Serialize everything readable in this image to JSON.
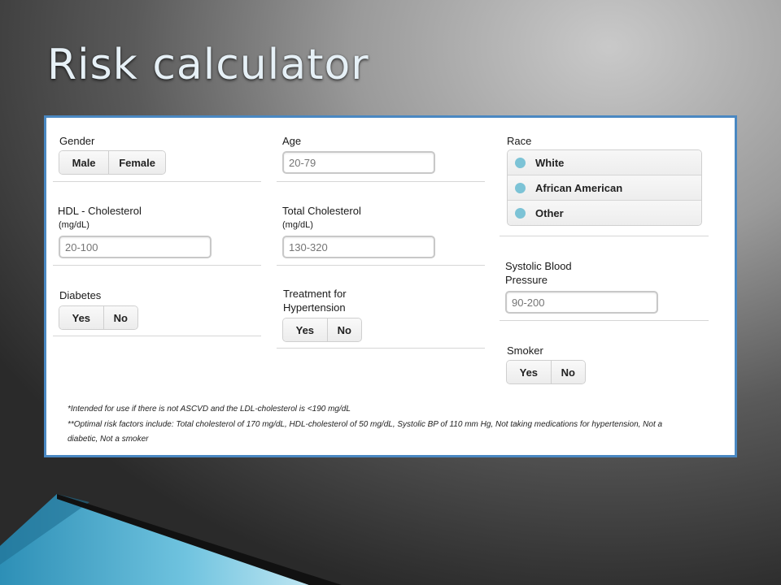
{
  "slide": {
    "title": "Risk calculator"
  },
  "gender": {
    "label": "Gender",
    "options": [
      "Male",
      "Female"
    ]
  },
  "age": {
    "label": "Age",
    "placeholder": "20-79"
  },
  "race": {
    "label": "Race",
    "options": [
      "White",
      "African American",
      "Other"
    ]
  },
  "hdl": {
    "label": "HDL - Cholesterol",
    "unit": "(mg/dL)",
    "placeholder": "20-100"
  },
  "total_chol": {
    "label": "Total Cholesterol",
    "unit": "(mg/dL)",
    "placeholder": "130-320"
  },
  "sbp": {
    "label_line1": "Systolic Blood",
    "label_line2": "Pressure",
    "placeholder": "90-200"
  },
  "diabetes": {
    "label": "Diabetes",
    "options": [
      "Yes",
      "No"
    ]
  },
  "treatment": {
    "label_line1": "Treatment for",
    "label_line2": "Hypertension",
    "options": [
      "Yes",
      "No"
    ]
  },
  "smoker": {
    "label": "Smoker",
    "options": [
      "Yes",
      "No"
    ]
  },
  "footnotes": {
    "note1": "*Intended for use if there is not ASCVD and the LDL-cholesterol is <190 mg/dL",
    "note2_line1": "**Optimal risk factors include: Total cholesterol of 170 mg/dL, HDL-cholesterol of 50 mg/dL, Systolic BP of 110 mm Hg, Not taking medications for hypertension, Not a",
    "note2_line2": "diabetic, Not a smoker"
  },
  "colors": {
    "panel_border": "#4a88c2",
    "radio_dot": "#7cc3d6",
    "title_text": "#e6f0f6"
  }
}
